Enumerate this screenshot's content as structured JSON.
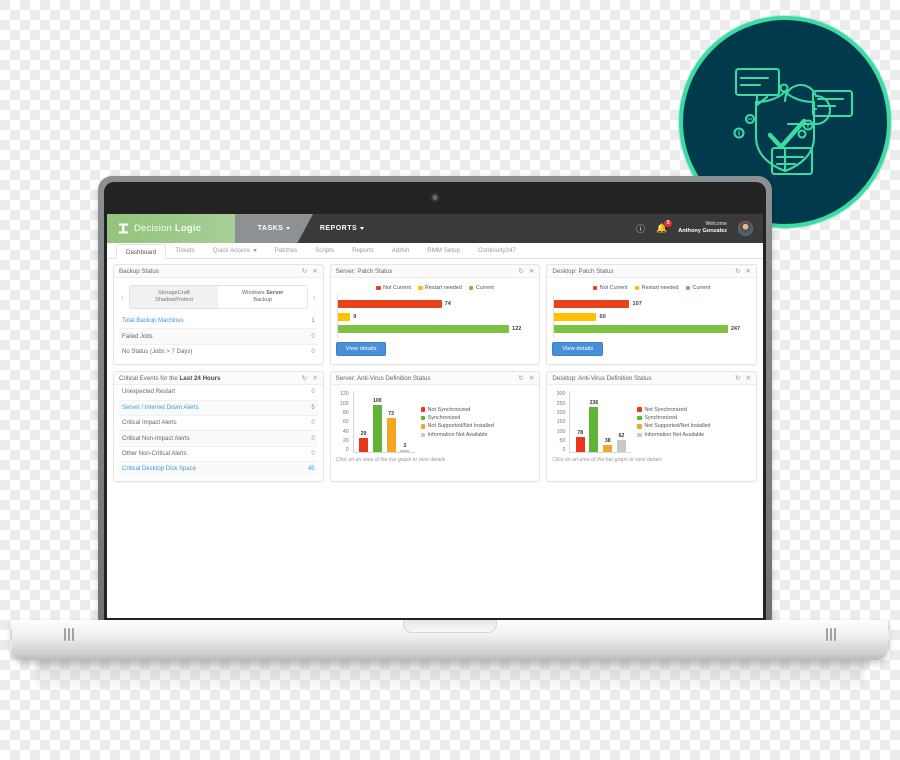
{
  "brand": {
    "name_light": "Decision ",
    "name_bold": "Logic",
    "logo_icon": "database-icon"
  },
  "topnav": {
    "tasks": "TASKS",
    "reports": "REPORTS",
    "help_icon": "help-circle-icon",
    "bell_icon": "bell-icon",
    "bell_count": "5",
    "welcome_line1": "Welcome",
    "welcome_line2": "Anthony Gonzalez",
    "avatar_icon": "user-avatar"
  },
  "tabs": [
    {
      "label": "Dashboard",
      "active": true
    },
    {
      "label": "Tickets",
      "active": false
    },
    {
      "label": "Quick Access",
      "active": false,
      "caret": true
    },
    {
      "label": "Patches",
      "active": false
    },
    {
      "label": "Scripts",
      "active": false
    },
    {
      "label": "Reports",
      "active": false
    },
    {
      "label": "Admin",
      "active": false
    },
    {
      "label": "RMM Setup",
      "active": false
    },
    {
      "label": "Continuity247",
      "active": false
    }
  ],
  "panel_tools": {
    "refresh_icon": "refresh-icon",
    "close_icon": "close-icon"
  },
  "backup": {
    "title": "Backup Status",
    "prev_icon": "chevron-left-icon",
    "next_icon": "chevron-right-icon",
    "carousel": [
      {
        "line1": "StorageCraft",
        "line2": "ShadowProtect",
        "selected": false
      },
      {
        "line1": "Windows ",
        "line2_bold": "Server",
        "line3": "Backup",
        "selected": true
      }
    ],
    "rows": [
      {
        "label": "Total Backup Machines",
        "value": "1",
        "link": true
      },
      {
        "label": "Failed Jobs",
        "value": "0",
        "link": false
      },
      {
        "label": "No Status (Jobs > 7 Days)",
        "value": "0",
        "link": false
      }
    ]
  },
  "critical": {
    "title_plain": "Critical Events for the ",
    "title_bold": "Last 24 Hours",
    "rows": [
      {
        "label": "Unexpected Restart",
        "value": "0",
        "link": false
      },
      {
        "label": "Server / Internet Down Alerts",
        "value": "5",
        "link": true
      },
      {
        "label": "Critical Impact Alerts",
        "value": "0",
        "link": false
      },
      {
        "label": "Critical Non-Impact Alerts",
        "value": "0",
        "link": false
      },
      {
        "label": "Other Non-Critical Alerts",
        "value": "0",
        "link": false
      },
      {
        "label": "Critical Desktop Disk Space",
        "value": "45",
        "link": true
      }
    ]
  },
  "colors": {
    "not_current": "#e8421a",
    "restart_needed": "#ffc000",
    "current": "#7dc242",
    "not_synchronized": "#e8371a",
    "synchronized": "#5fb336",
    "not_supported": "#f5a623",
    "info_not_available": "#c9c9c9",
    "button_blue": "#4a90d9",
    "brand_green": "#93c47d",
    "badge_teal": "#013a4d",
    "badge_mint": "#3ddba3",
    "link_blue": "#3a9bd6"
  },
  "view_details_label": "View details",
  "chart_hint": "Click on an area of the bar graph to view details",
  "chart_data": [
    {
      "type": "bar",
      "orientation": "horizontal",
      "title": "Server: Patch Status",
      "categories": [
        "Not Current",
        "Restart needed",
        "Current"
      ],
      "values": [
        74,
        9,
        122
      ],
      "colors": [
        "#e8421a",
        "#ffc000",
        "#7dc242"
      ],
      "legend": [
        "Not Current",
        "Restart needed",
        "Current"
      ],
      "legend_position": "top",
      "xlabel": "",
      "ylabel": "",
      "grid": false,
      "xlim": [
        0,
        140
      ]
    },
    {
      "type": "bar",
      "orientation": "horizontal",
      "title": "Desktop: Patch Status",
      "categories": [
        "Not Current",
        "Restart needed",
        "Current"
      ],
      "values": [
        107,
        60,
        247
      ],
      "colors": [
        "#e8421a",
        "#ffc000",
        "#7dc242"
      ],
      "legend": [
        "Not Current",
        "Restart needed",
        "Current"
      ],
      "legend_position": "top",
      "xlabel": "",
      "ylabel": "",
      "grid": false,
      "xlim": [
        0,
        280
      ]
    },
    {
      "type": "bar",
      "orientation": "vertical",
      "title": "Server: Anti-Virus Definition Status",
      "categories": [
        "Not Synchronized",
        "Synchronized",
        "Not Supported/Not Installed",
        "Information Not Available"
      ],
      "values": [
        29,
        100,
        73,
        3
      ],
      "colors": [
        "#e8371a",
        "#5fb336",
        "#f5a623",
        "#c9c9c9"
      ],
      "legend": [
        "Not Synchronized",
        "Synchronized",
        "Not Supported/Not Installed",
        "Information Not Available"
      ],
      "legend_position": "right",
      "ylim": [
        0,
        120
      ],
      "yticks": [
        120,
        100,
        80,
        60,
        40,
        20,
        0
      ],
      "xlabel": "",
      "ylabel": "",
      "grid": false,
      "annotation": "Click on an area of the bar graph to view details"
    },
    {
      "type": "bar",
      "orientation": "vertical",
      "title": "Desktop: Anti-Virus Definition Status",
      "categories": [
        "Not Synchronized",
        "Synchronized",
        "Not Supported/Not Installed",
        "Information Not Available"
      ],
      "values": [
        78,
        236,
        38,
        62
      ],
      "colors": [
        "#e8371a",
        "#5fb336",
        "#f5a623",
        "#c9c9c9"
      ],
      "legend": [
        "Not Synchronized",
        "Synchronized",
        "Not Supported/Not Installed",
        "Information Not Available"
      ],
      "legend_position": "right",
      "ylim": [
        0,
        300
      ],
      "yticks": [
        300,
        250,
        200,
        150,
        100,
        50,
        0
      ],
      "xlabel": "",
      "ylabel": "",
      "grid": false,
      "annotation": "Click on an area of the bar graph to view details"
    }
  ],
  "badge": {
    "icon": "cloud-shield-check-icon"
  }
}
